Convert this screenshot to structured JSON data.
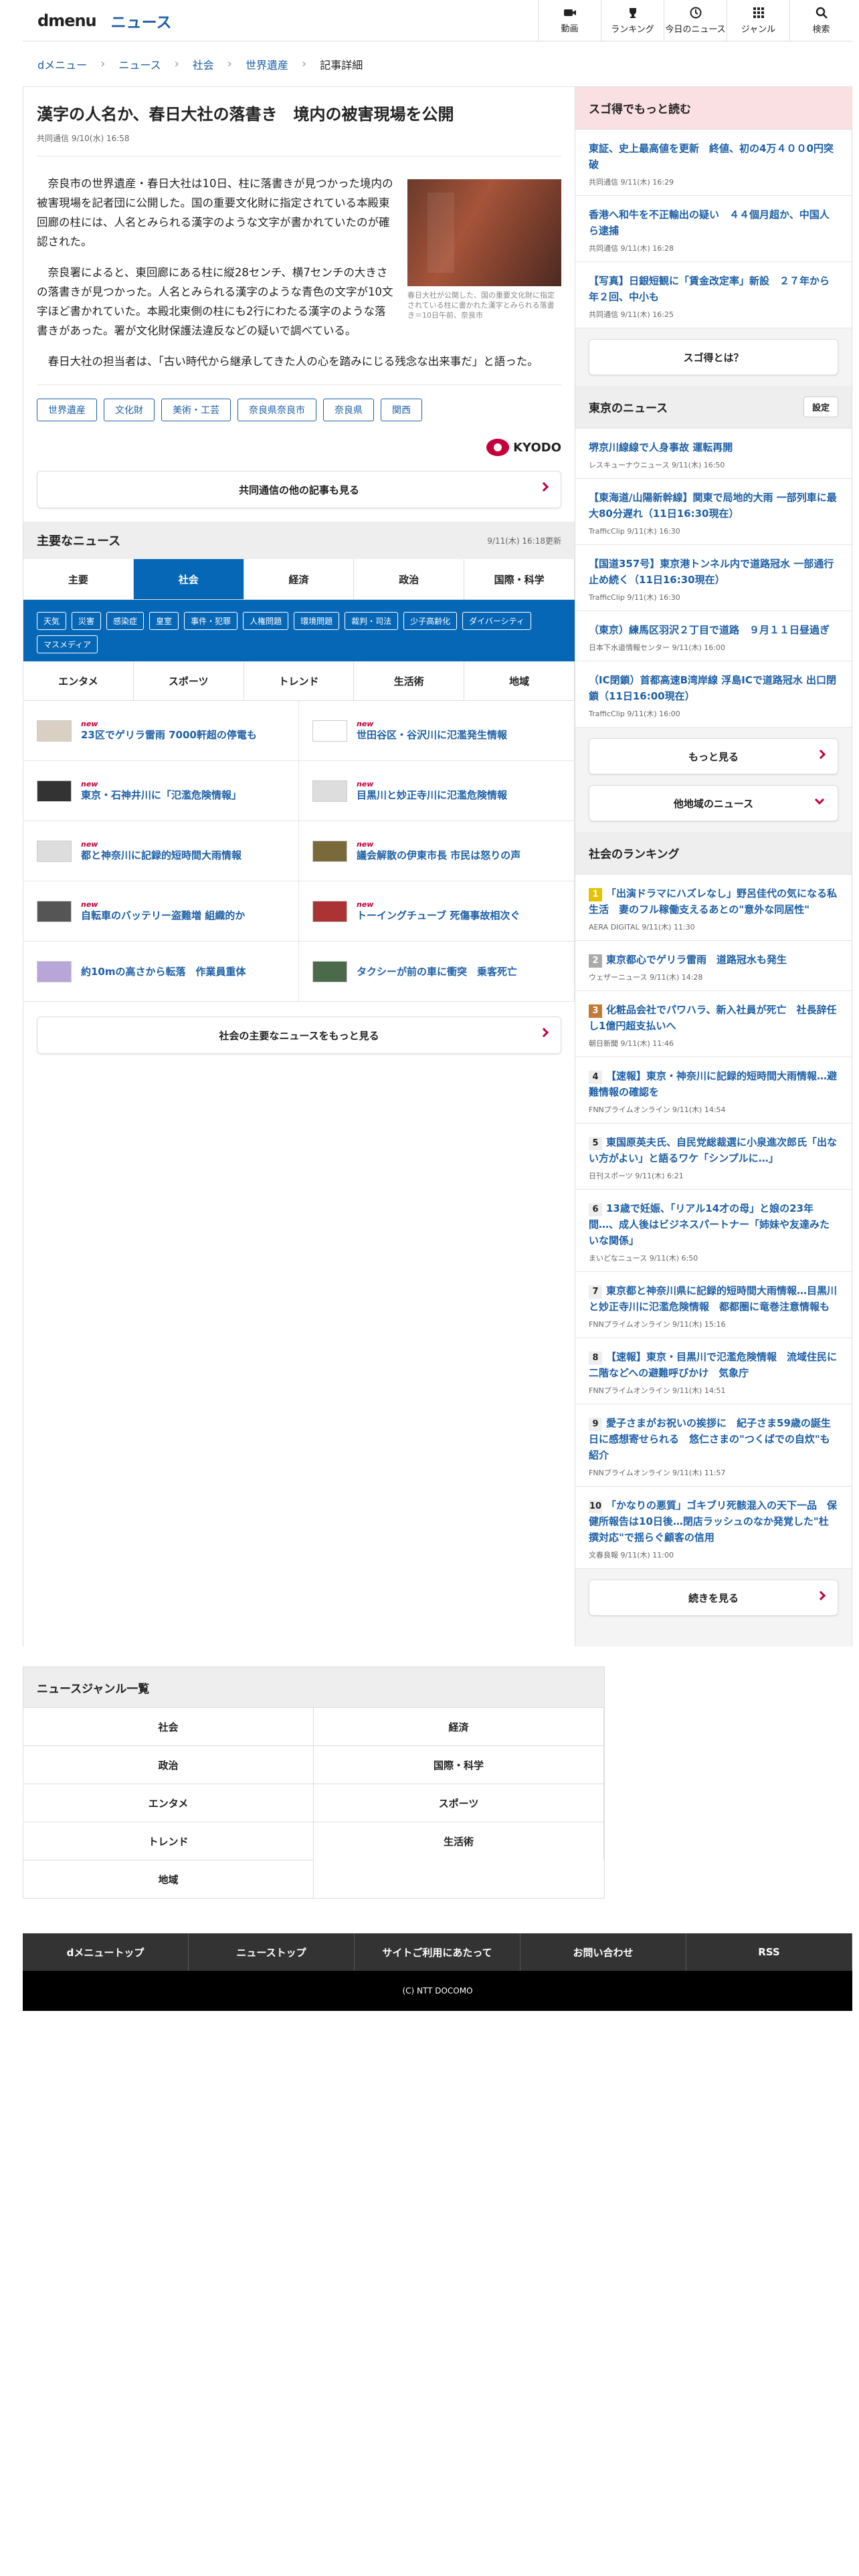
{
  "header": {
    "logo": "dmenu",
    "site_name": "ニュース",
    "nav": [
      "動画",
      "ランキング",
      "今日のニュース",
      "ジャンル",
      "検索"
    ]
  },
  "breadcrumb": [
    "dメニュー",
    "ニュース",
    "社会",
    "世界遺産",
    "記事詳細"
  ],
  "article": {
    "title": "漢字の人名か、春日大社の落書き　境内の被害現場を公開",
    "meta": "共同通信 9/10(水) 16:58",
    "photo_caption": "春日大社が公開した、国の重要文化財に指定されている柱に書かれた漢字とみられる落書き＝10日午前、奈良市",
    "paragraphs": [
      "奈良市の世界遺産・春日大社は10日、柱に落書きが見つかった境内の被害現場を記者団に公開した。国の重要文化財に指定されている本殿東回廊の柱には、人名とみられる漢字のような文字が書かれていたのが確認された。",
      "奈良署によると、東回廊にある柱に縦28センチ、横7センチの大きさの落書きが見つかった。人名とみられる漢字のような青色の文字が10文字ほど書かれていた。本殿北東側の柱にも2行にわたる漢字のような落書きがあった。署が文化財保護法違反などの疑いで調べている。",
      "春日大社の担当者は、「古い時代から継承してきた人の心を踏みにじる残念な出来事だ」と語った。"
    ],
    "tags": [
      "世界遺産",
      "文化財",
      "美術・工芸",
      "奈良県奈良市",
      "奈良県",
      "関西"
    ],
    "provider": "KYODO",
    "more_button": "共同通信の他の記事も見る"
  },
  "main_news": {
    "title": "主要なニュース",
    "updated": "9/11(木) 16:18更新",
    "tabs": [
      "主要",
      "社会",
      "経済",
      "政治",
      "国際・科学"
    ],
    "active_tab": "社会",
    "subtags": [
      "天気",
      "災害",
      "感染症",
      "皇室",
      "事件・犯罪",
      "人権問題",
      "環境問題",
      "裁判・司法",
      "少子高齢化",
      "ダイバーシティ",
      "マスメディア"
    ],
    "tabs2": [
      "エンタメ",
      "スポーツ",
      "トレンド",
      "生活術",
      "地域"
    ],
    "new_label": "new",
    "items": [
      {
        "title": "23区でゲリラ雷雨 7000軒超の停電も",
        "new": true,
        "thumb": "#d9cfc2"
      },
      {
        "title": "世田谷区・谷沢川に氾濫発生情報",
        "new": true,
        "thumb": "#fff"
      },
      {
        "title": "東京・石神井川に「氾濫危険情報」",
        "new": true,
        "thumb": "#333"
      },
      {
        "title": "目黒川と妙正寺川に氾濫危険情報",
        "new": true,
        "thumb": "#ddd"
      },
      {
        "title": "都と神奈川に記録的短時間大雨情報",
        "new": true,
        "thumb": "#ddd"
      },
      {
        "title": "議会解散の伊東市長 市民は怒りの声",
        "new": true,
        "thumb": "#7a6a3a"
      },
      {
        "title": "自転車のバッテリー盗難増 組織的か",
        "new": true,
        "thumb": "#555"
      },
      {
        "title": "トーイングチューブ 死傷事故相次ぐ",
        "new": true,
        "thumb": "#a33"
      },
      {
        "title": "約10mの高さから転落　作業員重体",
        "new": false,
        "thumb": "#b9a6d9"
      },
      {
        "title": "タクシーが前の車に衝突　乗客死亡",
        "new": false,
        "thumb": "#4a6a4a"
      }
    ],
    "more_button": "社会の主要なニュースをもっと見る"
  },
  "sugotoku": {
    "title": "スゴ得でもっと読む",
    "items": [
      {
        "title": "東証、史上最高値を更新　終値、初の4万４００0円突破",
        "source": "共同通信 9/11(木) 16:29"
      },
      {
        "title": "香港へ和牛を不正輸出の疑い　４４個月超か、中国人ら逮捕",
        "source": "共同通信 9/11(木) 16:28"
      },
      {
        "title": "【写真】日銀短観に「賃金改定率」新設　２７年から年２回、中小も",
        "source": "共同通信 9/11(木) 16:25"
      }
    ],
    "button": "スゴ得とは？"
  },
  "tokyo": {
    "title": "東京のニュース",
    "settings": "設定",
    "items": [
      {
        "title": "堺京川線線で人身事故 運転再開",
        "source": "レスキューナウニュース 9/11(木) 16:50"
      },
      {
        "title": "【東海道/山陽新幹線】関東で局地的大雨 一部列車に最大80分遅れ（11日16:30現在）",
        "source": "TrafficClip 9/11(木) 16:30"
      },
      {
        "title": "【国道357号】東京港トンネル内で道路冠水 一部通行止め続く（11日16:30現在）",
        "source": "TrafficClip 9/11(木) 16:30"
      },
      {
        "title": "（東京）練馬区羽沢２丁目で道路　９月１１日昼過ぎ",
        "source": "日本下水道情報センター 9/11(木) 16:00"
      },
      {
        "title": "（IC閉鎖）首都高速B湾岸線 浮島ICで道路冠水 出口閉鎖（11日16:00現在）",
        "source": "TrafficClip 9/11(木) 16:00"
      }
    ],
    "more": "もっと見る",
    "other": "他地域のニュース"
  },
  "ranking": {
    "title": "社会のランキング",
    "items": [
      {
        "rank": "1",
        "title": "「出演ドラマにハズレなし」野呂佳代の気になる私生活　妻のフル稼働支えるあとの\"意外な同居性\"",
        "source": "AERA DIGITAL 9/11(木) 11:30"
      },
      {
        "rank": "2",
        "title": "東京都心でゲリラ雷雨　道路冠水も発生",
        "source": "ウェザーニュース 9/11(木) 14:28"
      },
      {
        "rank": "3",
        "title": "化粧品会社でパワハラ、新入社員が死亡　社長辞任し1億円超支払いへ",
        "source": "朝日新聞 9/11(木) 11:46"
      },
      {
        "rank": "4",
        "title": "【速報】東京・神奈川に記録的短時間大雨情報…避難情報の確認を",
        "source": "FNNプライムオンライン 9/11(木) 14:54"
      },
      {
        "rank": "5",
        "title": "東国原英夫氏、自民党総裁選に小泉進次郎氏「出ない方がよい」と語るワケ「シンプルに…」",
        "source": "日刊スポーツ 9/11(木) 6:21"
      },
      {
        "rank": "6",
        "title": "13歳で妊娠、「リアル14才の母」と娘の23年間…、成人後はビジネスパートナー「姉妹や友達みたいな関係」",
        "source": "まいどなニュース 9/11(木) 6:50"
      },
      {
        "rank": "7",
        "title": "東京都と神奈川県に記録的短時間大雨情報…目黒川と妙正寺川に氾濫危険情報　都都圏に竜巻注意情報も",
        "source": "FNNプライムオンライン 9/11(木) 15:16"
      },
      {
        "rank": "8",
        "title": "【速報】東京・目黒川で氾濫危険情報　流域住民に二階などへの避難呼びかけ　気象庁",
        "source": "FNNプライムオンライン 9/11(木) 14:51"
      },
      {
        "rank": "9",
        "title": "愛子さまがお祝いの挨拶に　紀子さま59歳の誕生日に感想寄せられる　悠仁さまの\"つくばでの自炊\"も紹介",
        "source": "FNNプライムオンライン 9/11(木) 11:57"
      },
      {
        "rank": "10",
        "title": "「かなりの悪質」ゴキブリ死骸混入の天下一品　保健所報告は10日後…閉店ラッシュのなか発覚した\"杜撰対応\"で揺らぐ顧客の信用",
        "source": "文春良報 9/11(木) 11:00"
      }
    ],
    "more": "続きを見る"
  },
  "genre": {
    "title": "ニュースジャンル一覧",
    "items": [
      "社会",
      "経済",
      "政治",
      "国際・科学",
      "エンタメ",
      "スポーツ",
      "トレンド",
      "生活術",
      "地域"
    ]
  },
  "footer": {
    "links": [
      "dメニュートップ",
      "ニューストップ",
      "サイトご利用にあたって",
      "お問い合わせ",
      "RSS"
    ],
    "copyright": "(C) NTT DOCOMO"
  }
}
